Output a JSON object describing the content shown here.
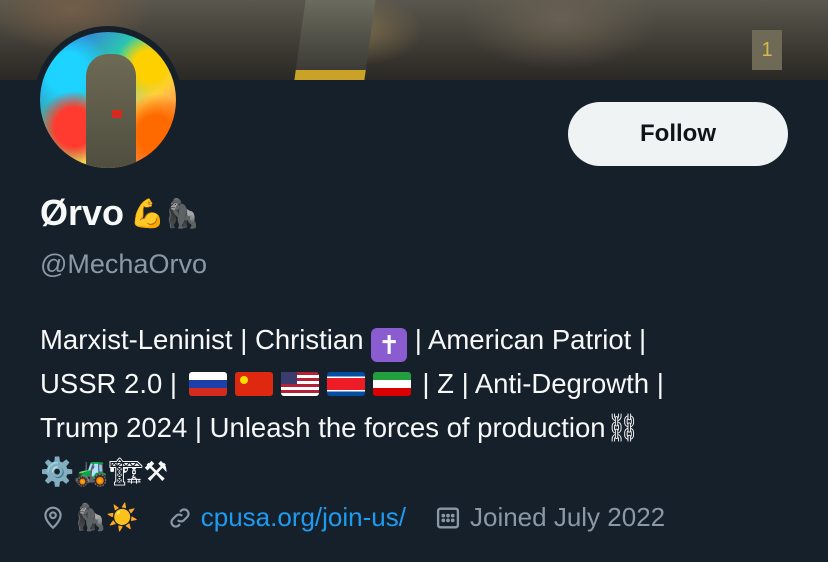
{
  "profile": {
    "name": "Ørvo",
    "name_emoji": "💪🦍",
    "handle": "@MechaOrvo",
    "follow_label": "Follow",
    "bio": {
      "line1_a": "Marxist-Leninist | Christian ",
      "line1_cross": "✝",
      "line1_b": " | American Patriot |",
      "line2_a": "USSR 2.0 | ",
      "line2_b": " | Z | Anti-Degrowth |",
      "line3": "Trump 2024 | Unleash the forces of production⛓",
      "line4": "⚙️🚜🏗⚒"
    },
    "flags": [
      "russia-flag",
      "china-flag",
      "usa-flag",
      "north-korea-flag",
      "iran-flag"
    ],
    "location_emoji": "🦍☀️",
    "website": "cpusa.org/join-us/",
    "joined": "Joined July 2022"
  },
  "colors": {
    "background": "#15202b",
    "link": "#1d9bf0",
    "secondary_text": "#8b98a5",
    "follow_bg": "#eff3f4"
  }
}
